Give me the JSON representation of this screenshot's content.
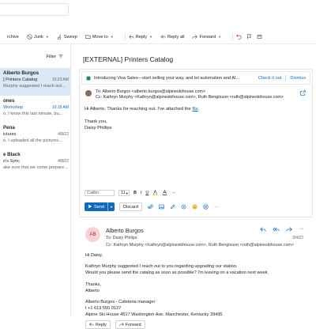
{
  "toolbar": {
    "items": [
      {
        "label": "rchive"
      },
      {
        "label": "Junk"
      },
      {
        "label": "Sweep"
      },
      {
        "label": "Move to"
      },
      {
        "label": "Reply"
      },
      {
        "label": "Reply all"
      },
      {
        "label": "Forward"
      }
    ]
  },
  "list": {
    "filter_label": "Filter",
    "items": [
      {
        "sender": "Alberto Burgos",
        "subject": "] Printers Catalog",
        "time": "10:23 AM",
        "preview": "Murphy suggested I reach out..."
      },
      {
        "sender": "ones",
        "subject": "Workshop",
        "time": "10:15 AM",
        "preview": "o, I know this last minute, bu..."
      },
      {
        "sender": "Pena",
        "subject": "ictures",
        "time": "4/8/22",
        "preview": "o, I uploaded all the pictures..."
      },
      {
        "sender": "e Black",
        "subject": "o's Sync",
        "time": "4/8/22",
        "preview": "ake sure that we come prepare..."
      }
    ]
  },
  "reading": {
    "subject": "[EXTERNAL] Printers Catalog",
    "banner": {
      "text": "Introducing Viva Sales—start selling your way, and let automation and AI...",
      "check_label": "Check it out",
      "dismiss_label": "Dismiss"
    },
    "draft": {
      "to": "To: Alberto Burgos <alberto.burgos@alpineskihouse.com>",
      "cc": "Cc: Kathryn Murphy <Kathryn@alpineskihouse.com>, Ruth Bengtsson <ruth@alpineskihouse.com>",
      "body_pre": "Hi Alberto, Thanks for reaching out. I've attached the ",
      "body_link": "file",
      "body_post": ".",
      "thanks": "Thank you,",
      "signature": "Daisy Phillips",
      "font": "Calibri",
      "size": "11",
      "bold": "B",
      "italic": "I",
      "underline": "U",
      "send_label": "Send",
      "discard_label": "Discard"
    },
    "message": {
      "avatar_initials": "AB",
      "from": "Alberto Burgos",
      "to": "To: Daisy Philips",
      "cc": "Cc: Kathryn Murphy <Kathryn@alpineskihouse.com>, Ruth Bengtsson <ruth@alpineskihouse.com>",
      "date": "3/4/22",
      "greeting": "Hi Daisy,",
      "line1": "Kathryn Murphy suggested I reach out to you regarding upgrading our station.",
      "line2": "Would you please send the catalog as soon as possible? I'm leaving on a vacation next week.",
      "thanks": "Thanks,",
      "name": "Alberto",
      "sig1": "Alberto Burgos - Cafeteria manager",
      "sig2": "t +1 619 555 0127",
      "sig3": "Alpine Ski House 4517 Washington Ave. Manchester, Kentucky 39495",
      "reply_label": "Reply",
      "forward_label": "Forward"
    }
  },
  "colors": {
    "accent": "#0f6cbd",
    "selected": "#dbe8f6",
    "avatar_bg": "#f8d3d6",
    "avatar_fg": "#a4262c"
  }
}
